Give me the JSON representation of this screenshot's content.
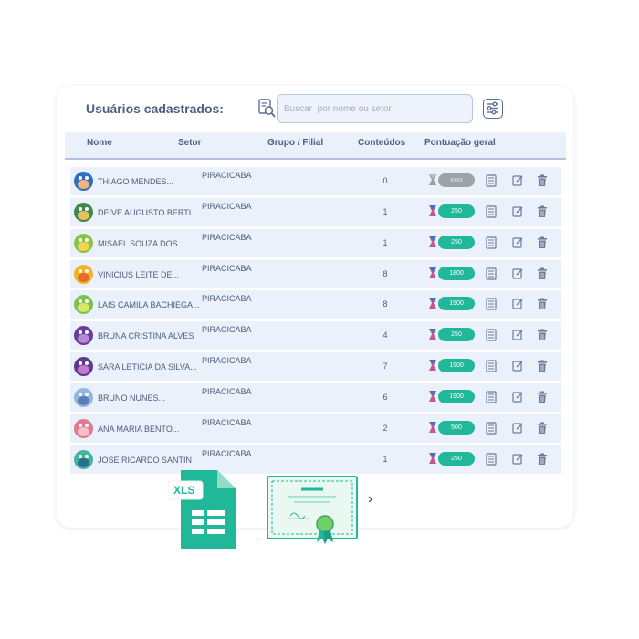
{
  "header": {
    "title": "Usuários cadastrados:",
    "search_placeholder": "Buscar  por nome ou setor"
  },
  "columns": {
    "nome": "Nome",
    "setor": "Setor",
    "grupo": "Grupo / Filial",
    "conteudos": "Conteúdos",
    "pontuacao": "Pontuação geral"
  },
  "rows": [
    {
      "name": "THIAGO MENDES...",
      "setor": "PIRACICABA",
      "count": "0",
      "score": "xxxx",
      "score_state": "gray",
      "avatar_color": "#2f6fbf",
      "avatar_accent": "#f2b37c"
    },
    {
      "name": "DEIVE AUGUSTO BERTI",
      "setor": "PIRACICABA",
      "count": "1",
      "score": "250",
      "score_state": "green",
      "avatar_color": "#3e8a4c",
      "avatar_accent": "#e7c25a"
    },
    {
      "name": "MISAEL SOUZA DOS...",
      "setor": "PIRACICABA",
      "count": "1",
      "score": "250",
      "score_state": "green",
      "avatar_color": "#8bc24a",
      "avatar_accent": "#f4d34f"
    },
    {
      "name": "VINICIUS LEITE DE...",
      "setor": "PIRACICABA",
      "count": "8",
      "score": "1800",
      "score_state": "green",
      "avatar_color": "#f0b428",
      "avatar_accent": "#e56d2a"
    },
    {
      "name": "LAIS CAMILA BACHIEGA...",
      "setor": "PIRACICABA",
      "count": "8",
      "score": "1900",
      "score_state": "green",
      "avatar_color": "#7cc250",
      "avatar_accent": "#d8e86a"
    },
    {
      "name": "BRUNA CRISTINA ALVES",
      "setor": "PIRACICABA",
      "count": "4",
      "score": "250",
      "score_state": "green",
      "avatar_color": "#6a3d9a",
      "avatar_accent": "#b38ad8"
    },
    {
      "name": "SARA LETICIA DA SILVA...",
      "setor": "PIRACICABA",
      "count": "7",
      "score": "1900",
      "score_state": "green",
      "avatar_color": "#5c3a8c",
      "avatar_accent": "#c07ad0"
    },
    {
      "name": "BRUNO NUNES...",
      "setor": "PIRACICABA",
      "count": "6",
      "score": "1900",
      "score_state": "green",
      "avatar_color": "#8fb7e0",
      "avatar_accent": "#5a7fb8"
    },
    {
      "name": "ANA MARIA BENTO...",
      "setor": "PIRACICABA",
      "count": "2",
      "score": "500",
      "score_state": "green",
      "avatar_color": "#e07a8c",
      "avatar_accent": "#f7c0c8"
    },
    {
      "name": "JOSE RICARDO SANTIN",
      "setor": "PIRACICABA",
      "count": "1",
      "score": "250",
      "score_state": "green",
      "avatar_color": "#45b3a0",
      "avatar_accent": "#2a6f8a"
    }
  ],
  "exports": {
    "xls_label": "XLS"
  },
  "icons": {
    "search": "search-icon",
    "filter": "filter-sliders-icon",
    "trophy": "trophy-icon",
    "doc": "document-icon",
    "edit": "edit-icon",
    "trash": "trash-icon",
    "next": "chevron-right-icon"
  },
  "colors": {
    "accent_green": "#21b89a",
    "row_bg": "#eaf1fb",
    "title": "#4d5f80"
  }
}
